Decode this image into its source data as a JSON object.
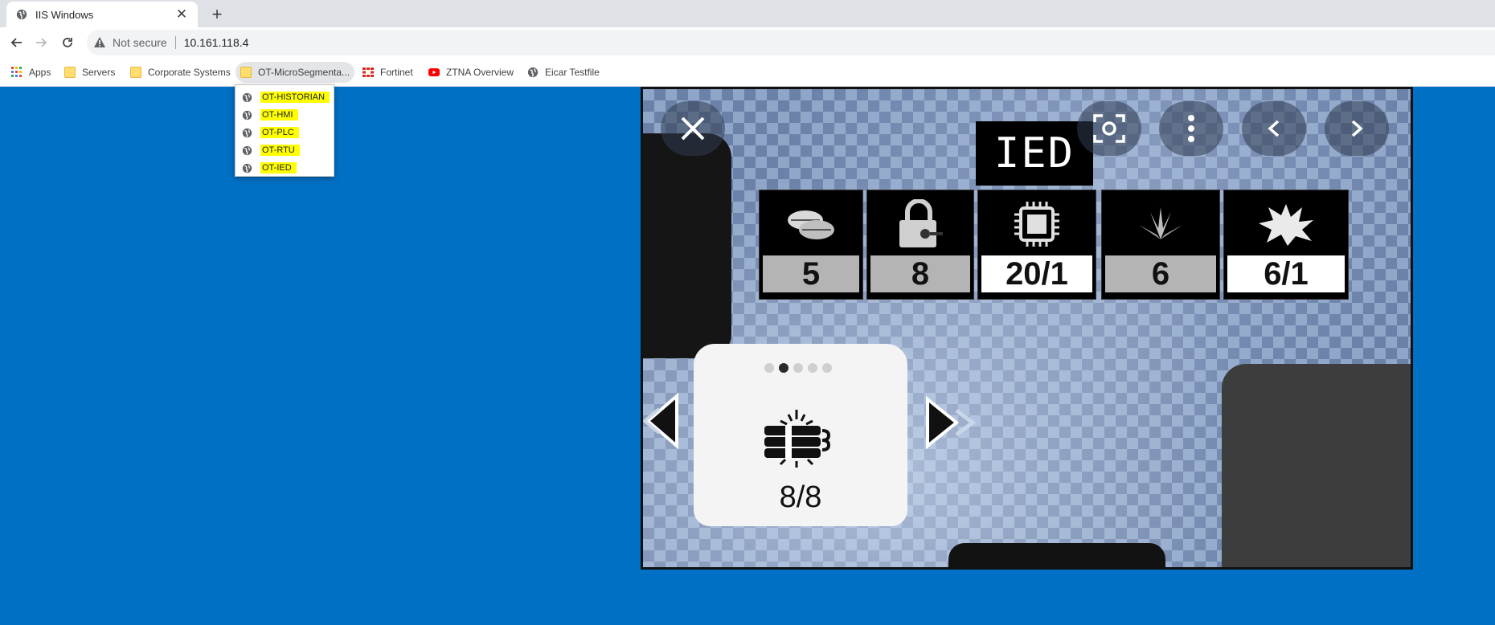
{
  "tab": {
    "title": "IIS Windows",
    "close": "✕"
  },
  "newtab": "+",
  "address": {
    "security": "Not secure",
    "url": "10.161.118.4"
  },
  "bookmarks": [
    {
      "label": "Apps"
    },
    {
      "label": "Servers"
    },
    {
      "label": "Corporate Systems"
    },
    {
      "label": "OT-MicroSegmenta..."
    },
    {
      "label": "Fortinet"
    },
    {
      "label": "ZTNA Overview"
    },
    {
      "label": "Eicar Testfile"
    }
  ],
  "dropdown": [
    {
      "label": "OT-HISTORIAN"
    },
    {
      "label": "OT-HMI"
    },
    {
      "label": "OT-PLC"
    },
    {
      "label": "OT-RTU"
    },
    {
      "label": "OT-IED"
    }
  ],
  "game": {
    "title": "IED",
    "stats": [
      {
        "icon": "pills-icon",
        "value": "5"
      },
      {
        "icon": "lock-key-icon",
        "value": "8"
      },
      {
        "icon": "chip-icon",
        "value": "20/1"
      },
      {
        "icon": "spark-icon",
        "value": "6"
      },
      {
        "icon": "explosion-icon",
        "value": "6/1"
      }
    ],
    "card": {
      "icon": "dynamite-icon",
      "value": "8/8",
      "page_count": 5,
      "active_page": 2
    }
  },
  "colors": {
    "desktop": "#0070c4",
    "highlight": "#ffff00"
  }
}
